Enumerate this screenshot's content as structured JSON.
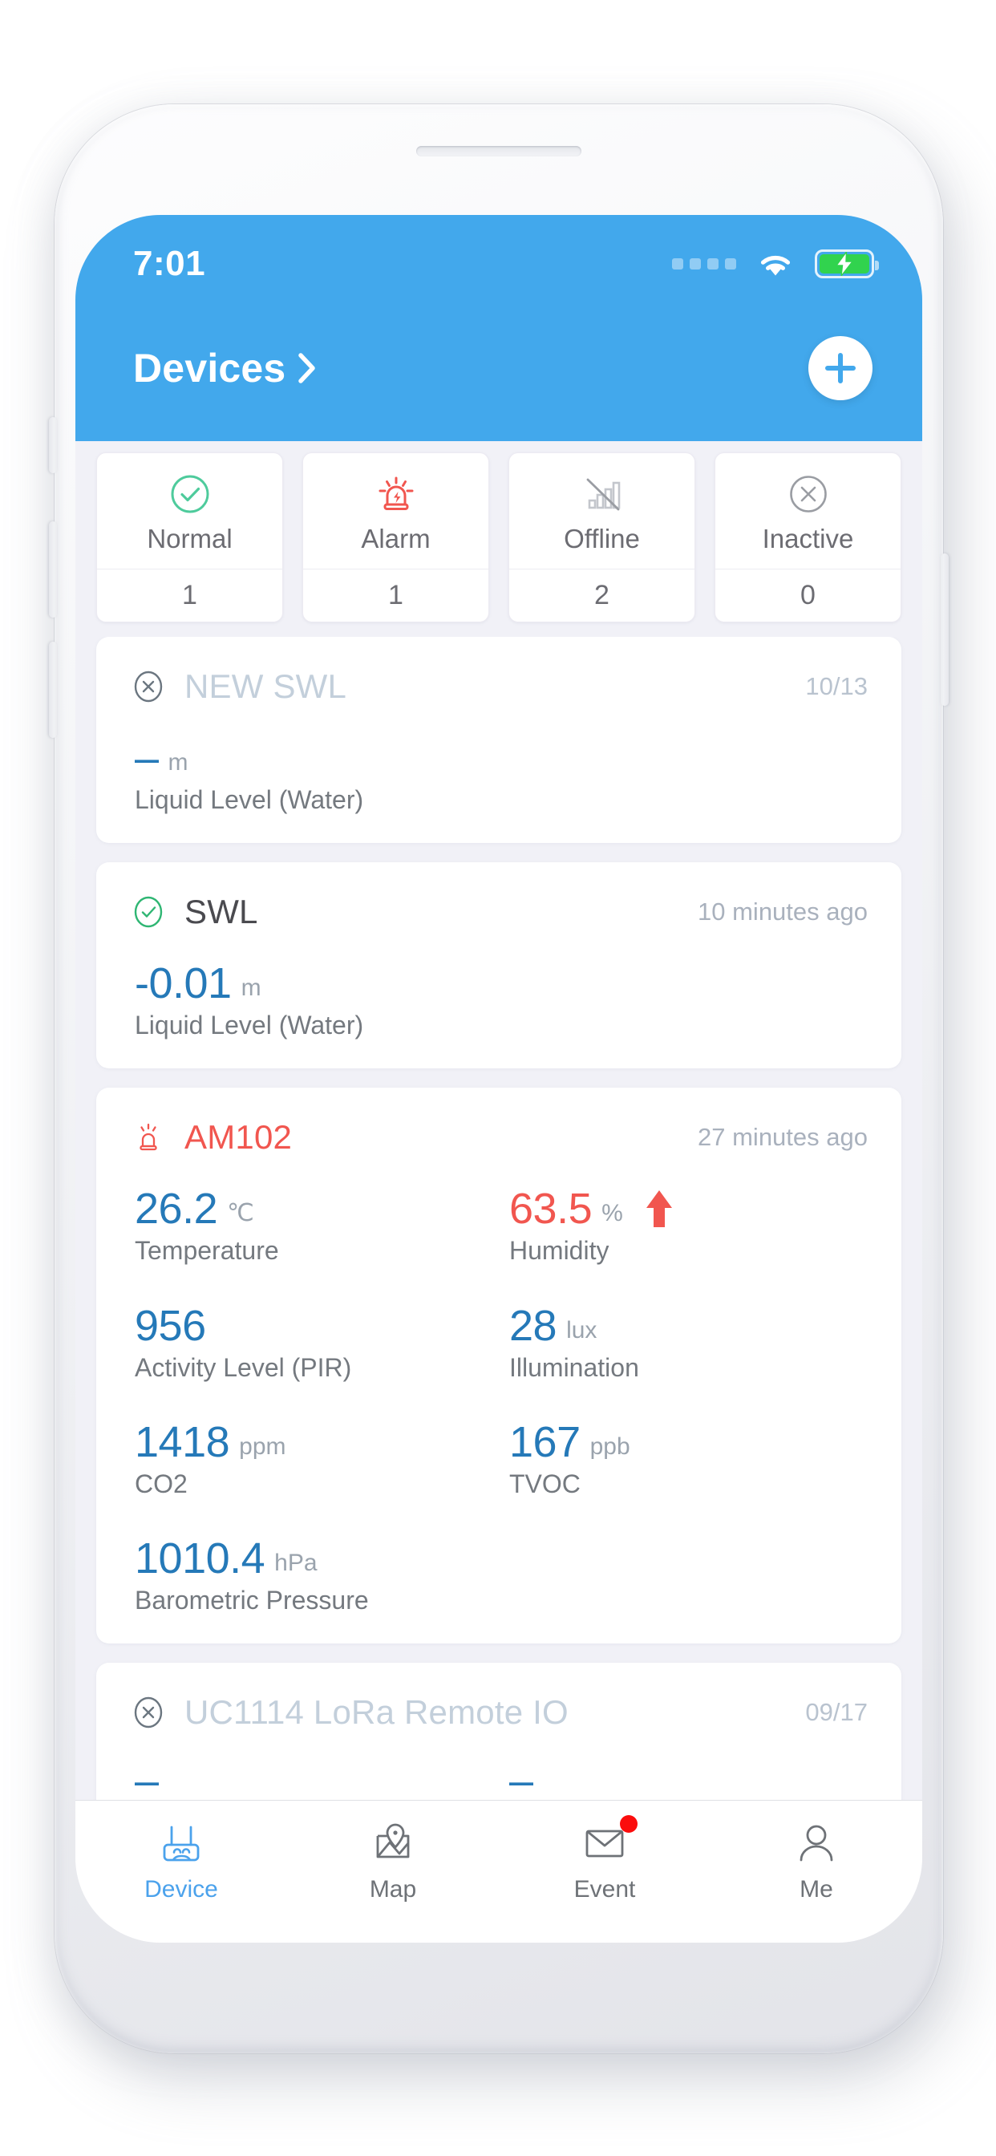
{
  "status_bar": {
    "time": "7:01",
    "signal_icon": "signal-dots-icon",
    "wifi_icon": "wifi-icon",
    "battery_icon": "battery-charging-icon",
    "battery_color": "#31d34e"
  },
  "header": {
    "title": "Devices",
    "chevron_icon": "chevron-right-icon",
    "add_icon": "plus-icon",
    "background_color": "#42a8ec"
  },
  "summary": {
    "cards": [
      {
        "label": "Normal",
        "count": "1",
        "icon": "check-circle-icon",
        "color": "#4ecb9c"
      },
      {
        "label": "Alarm",
        "count": "1",
        "icon": "siren-icon",
        "color": "#f1564f"
      },
      {
        "label": "Offline",
        "count": "2",
        "icon": "signal-off-icon",
        "color": "#c3c6cc"
      },
      {
        "label": "Inactive",
        "count": "0",
        "icon": "x-circle-icon",
        "color": "#9a9da3"
      }
    ]
  },
  "devices": [
    {
      "name": "NEW SWL",
      "status": "inactive",
      "status_icon": "x-circle-icon",
      "time": "10/13",
      "metrics": [
        {
          "value": "–",
          "unit": "m",
          "label": "Liquid Level (Water)",
          "state": "normal",
          "trend": ""
        }
      ]
    },
    {
      "name": "SWL",
      "status": "normal",
      "status_icon": "check-circle-icon",
      "time": "10 minutes ago",
      "metrics": [
        {
          "value": "-0.01",
          "unit": "m",
          "label": "Liquid Level (Water)",
          "state": "normal",
          "trend": ""
        }
      ]
    },
    {
      "name": "AM102",
      "status": "alarm",
      "status_icon": "siren-icon",
      "time": "27 minutes ago",
      "metrics": [
        {
          "value": "26.2",
          "unit": "℃",
          "label": "Temperature",
          "state": "normal",
          "trend": ""
        },
        {
          "value": "63.5",
          "unit": "%",
          "label": "Humidity",
          "state": "alarm",
          "trend": "up"
        },
        {
          "value": "956",
          "unit": "",
          "label": "Activity Level (PIR)",
          "state": "normal",
          "trend": ""
        },
        {
          "value": "28",
          "unit": "lux",
          "label": "Illumination",
          "state": "normal",
          "trend": ""
        },
        {
          "value": "1418",
          "unit": "ppm",
          "label": "CO2",
          "state": "normal",
          "trend": ""
        },
        {
          "value": "167",
          "unit": "ppb",
          "label": "TVOC",
          "state": "normal",
          "trend": ""
        },
        {
          "value": "1010.4",
          "unit": "hPa",
          "label": "Barometric Pressure",
          "state": "normal",
          "trend": ""
        }
      ]
    },
    {
      "name": "UC1114 LoRa Remote IO",
      "status": "inactive",
      "status_icon": "x-circle-icon",
      "time": "09/17",
      "metrics": []
    }
  ],
  "tabbar": {
    "tabs": [
      {
        "label": "Device",
        "icon": "router-icon",
        "active": true,
        "badge": false
      },
      {
        "label": "Map",
        "icon": "map-pin-icon",
        "active": false,
        "badge": false
      },
      {
        "label": "Event",
        "icon": "envelope-icon",
        "active": false,
        "badge": true
      },
      {
        "label": "Me",
        "icon": "person-icon",
        "active": false,
        "badge": false
      }
    ]
  },
  "colors": {
    "accent_blue": "#42a8ec",
    "value_blue": "#2579b8",
    "alarm_red": "#f1564f",
    "normal_green": "#4ecb9c",
    "page_bg": "#f1f1f7",
    "badge_red": "#fb0d0d"
  }
}
